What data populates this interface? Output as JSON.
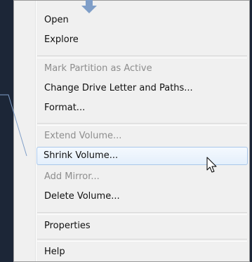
{
  "context_menu": {
    "items": [
      {
        "label": "Open"
      },
      {
        "label": "Explore"
      },
      {
        "label": "Mark Partition as Active"
      },
      {
        "label": "Change Drive Letter and Paths..."
      },
      {
        "label": "Format..."
      },
      {
        "label": "Extend Volume..."
      },
      {
        "label": "Shrink Volume..."
      },
      {
        "label": "Add Mirror..."
      },
      {
        "label": "Delete Volume..."
      },
      {
        "label": "Properties"
      },
      {
        "label": "Help"
      }
    ]
  },
  "colors": {
    "background": "#1c2637",
    "menu": "#f0f0f0",
    "highlight_border": "#a9c7ea",
    "callout": "#7f9ec8"
  }
}
